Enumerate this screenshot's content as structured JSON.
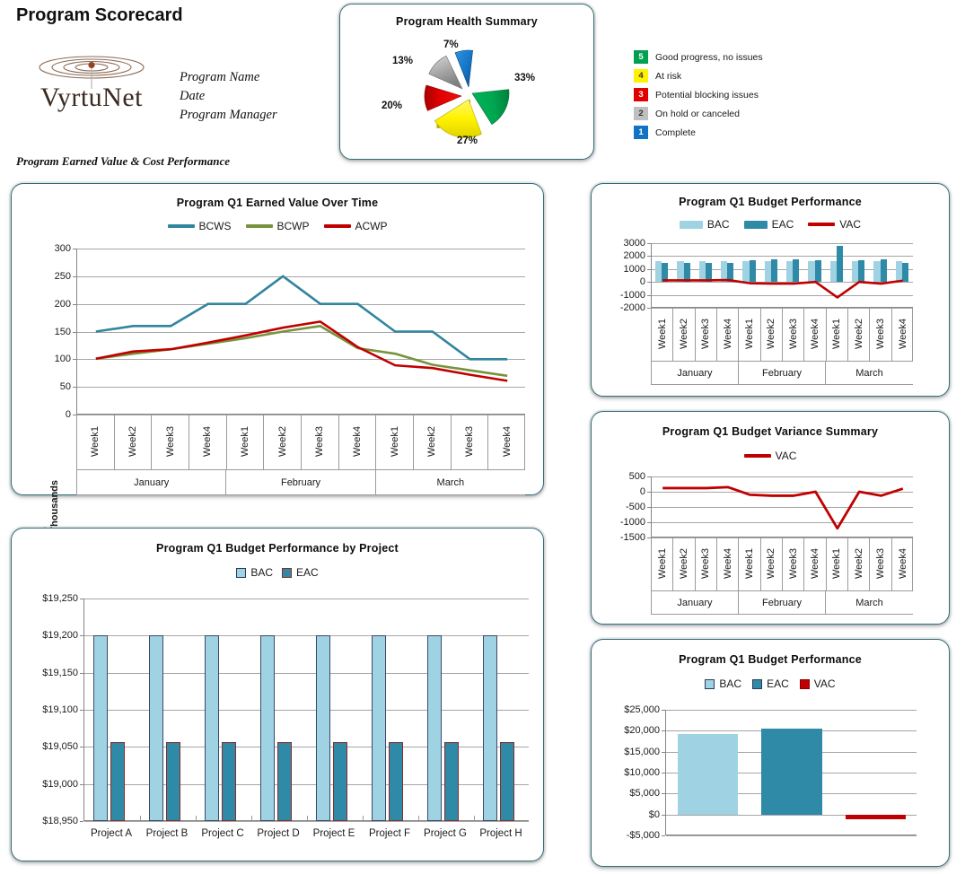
{
  "header": {
    "title": "Program Scorecard",
    "logo_text": "VyrtuNet",
    "logo_icon": "ripple-logo-icon",
    "meta_lines": [
      "Program Name",
      "Date",
      "Program Manager"
    ],
    "section_label": "Program Earned Value & Cost Performance"
  },
  "health": {
    "title": "Program Health Summary"
  },
  "status_legend": {
    "items": [
      {
        "key": "5",
        "label": "Good progress, no issues",
        "color": "#00A050",
        "text_color": "#ffffff"
      },
      {
        "key": "4",
        "label": "At risk",
        "color": "#FFF200",
        "text_color": "#333333"
      },
      {
        "key": "3",
        "label": "Potential blocking issues",
        "color": "#E00000",
        "text_color": "#ffffff"
      },
      {
        "key": "2",
        "label": "On hold or canceled",
        "color": "#BFBFBF",
        "text_color": "#333333"
      },
      {
        "key": "1",
        "label": "Complete",
        "color": "#1273C4",
        "text_color": "#ffffff"
      }
    ]
  },
  "colors": {
    "bcws": "#31859C",
    "bcwp": "#77933C",
    "acwp": "#C00000",
    "bac": "#9FD3E3",
    "eac": "#2E8AA6",
    "vac": "#C00000",
    "panel_border": "#2e6d78"
  },
  "weeks": [
    "Week1",
    "Week2",
    "Week3",
    "Week4",
    "Week1",
    "Week2",
    "Week3",
    "Week4",
    "Week1",
    "Week2",
    "Week3",
    "Week4"
  ],
  "months": [
    "January",
    "February",
    "March"
  ],
  "chart_data": [
    {
      "id": "health_pie",
      "type": "pie",
      "title": "Program Health Summary",
      "labels": [
        "33%",
        "27%",
        "20%",
        "13%",
        "7%"
      ],
      "categories": [
        "Good progress, no issues",
        "At risk",
        "Potential blocking issues",
        "On hold or canceled",
        "Complete"
      ],
      "values": [
        33,
        27,
        20,
        13,
        7
      ],
      "colors": [
        "#00A64F",
        "#FFF200",
        "#E00000",
        "#A6A6A6",
        "#1273C4"
      ],
      "exploded": true,
      "legend": "external"
    },
    {
      "id": "earned_value",
      "type": "line",
      "title": "Program Q1 Earned Value Over Time",
      "ylabel": "$ Thousands",
      "xlabel": "",
      "ylim": [
        0,
        300
      ],
      "yticks": [
        0,
        50,
        100,
        150,
        200,
        250,
        300
      ],
      "grid": true,
      "legend": "top",
      "categories": [
        "Week1",
        "Week2",
        "Week3",
        "Week4",
        "Week1",
        "Week2",
        "Week3",
        "Week4",
        "Week1",
        "Week2",
        "Week3",
        "Week4"
      ],
      "groups": [
        "January",
        "February",
        "March"
      ],
      "series": [
        {
          "name": "BCWS",
          "color": "#31859C",
          "values": [
            150,
            160,
            160,
            200,
            200,
            250,
            200,
            200,
            150,
            150,
            100,
            100
          ]
        },
        {
          "name": "BCWP",
          "color": "#77933C",
          "values": [
            101,
            110,
            118,
            128,
            138,
            150,
            160,
            120,
            110,
            90,
            80,
            70
          ]
        },
        {
          "name": "ACWP",
          "color": "#C00000",
          "values": [
            101,
            114,
            118,
            130,
            143,
            157,
            168,
            122,
            89,
            84,
            72,
            61
          ]
        }
      ]
    },
    {
      "id": "budget_performance_weekly",
      "type": "bar",
      "title": "Program Q1 Budget Performance",
      "ylim": [
        -2000,
        3000
      ],
      "yticks": [
        -2000,
        -1000,
        0,
        1000,
        2000,
        3000
      ],
      "grid": true,
      "legend": "top",
      "categories": [
        "Week1",
        "Week2",
        "Week3",
        "Week4",
        "Week1",
        "Week2",
        "Week3",
        "Week4",
        "Week1",
        "Week2",
        "Week3",
        "Week4"
      ],
      "groups": [
        "January",
        "February",
        "March"
      ],
      "series": [
        {
          "name": "BAC",
          "type": "bar",
          "color": "#9FD3E3",
          "values": [
            1600,
            1600,
            1600,
            1600,
            1600,
            1600,
            1600,
            1600,
            1600,
            1600,
            1600,
            1600
          ]
        },
        {
          "name": "EAC",
          "type": "bar",
          "color": "#2E8AA6",
          "values": [
            1480,
            1470,
            1450,
            1450,
            1700,
            1720,
            1720,
            1650,
            2800,
            1650,
            1720,
            1480
          ]
        },
        {
          "name": "VAC",
          "type": "line",
          "color": "#C00000",
          "values": [
            120,
            120,
            120,
            150,
            -100,
            -130,
            -130,
            0,
            -1200,
            0,
            -130,
            100
          ]
        }
      ]
    },
    {
      "id": "budget_variance_summary",
      "type": "line",
      "title": "Program Q1 Budget Variance Summary",
      "ylim": [
        -1500,
        500
      ],
      "yticks": [
        -1500,
        -1000,
        -500,
        0,
        500
      ],
      "grid": true,
      "legend": "top",
      "categories": [
        "Week1",
        "Week2",
        "Week3",
        "Week4",
        "Week1",
        "Week2",
        "Week3",
        "Week4",
        "Week1",
        "Week2",
        "Week3",
        "Week4"
      ],
      "groups": [
        "January",
        "February",
        "March"
      ],
      "series": [
        {
          "name": "VAC",
          "color": "#C00000",
          "values": [
            120,
            120,
            120,
            150,
            -100,
            -130,
            -130,
            0,
            -1200,
            0,
            -130,
            100
          ]
        }
      ]
    },
    {
      "id": "budget_by_project",
      "type": "bar",
      "title": "Program Q1 Budget Performance by Project",
      "ylim": [
        18950,
        19250
      ],
      "yticks": [
        18950,
        19000,
        19050,
        19100,
        19150,
        19200,
        19250
      ],
      "ytick_labels": [
        "$18,950",
        "$19,000",
        "$19,050",
        "$19,100",
        "$19,150",
        "$19,200",
        "$19,250"
      ],
      "grid": true,
      "legend": "top",
      "categories": [
        "Project A",
        "Project B",
        "Project C",
        "Project D",
        "Project E",
        "Project F",
        "Project G",
        "Project H"
      ],
      "series": [
        {
          "name": "BAC",
          "color": "#9FD3E3",
          "values": [
            19200,
            19200,
            19200,
            19200,
            19200,
            19200,
            19200,
            19200
          ]
        },
        {
          "name": "EAC",
          "color": "#2E8AA6",
          "values": [
            19057,
            19057,
            19057,
            19057,
            19057,
            19057,
            19057,
            19057
          ]
        }
      ]
    },
    {
      "id": "budget_performance_total",
      "type": "bar",
      "title": "Program Q1 Budget Performance",
      "ylim": [
        -5000,
        25000
      ],
      "yticks": [
        -5000,
        0,
        5000,
        10000,
        15000,
        20000,
        25000
      ],
      "ytick_labels": [
        "-$5,000",
        "$0",
        "$5,000",
        "$10,000",
        "$15,000",
        "$20,000",
        "$25,000"
      ],
      "grid": true,
      "legend": "top",
      "categories": [
        "BAC",
        "EAC",
        "VAC"
      ],
      "series": [
        {
          "name": "BAC",
          "color": "#9FD3E3",
          "values": [
            19300
          ]
        },
        {
          "name": "EAC",
          "color": "#2E8AA6",
          "values": [
            20400
          ]
        },
        {
          "name": "VAC",
          "color": "#C00000",
          "values": [
            -1100
          ]
        }
      ]
    }
  ]
}
